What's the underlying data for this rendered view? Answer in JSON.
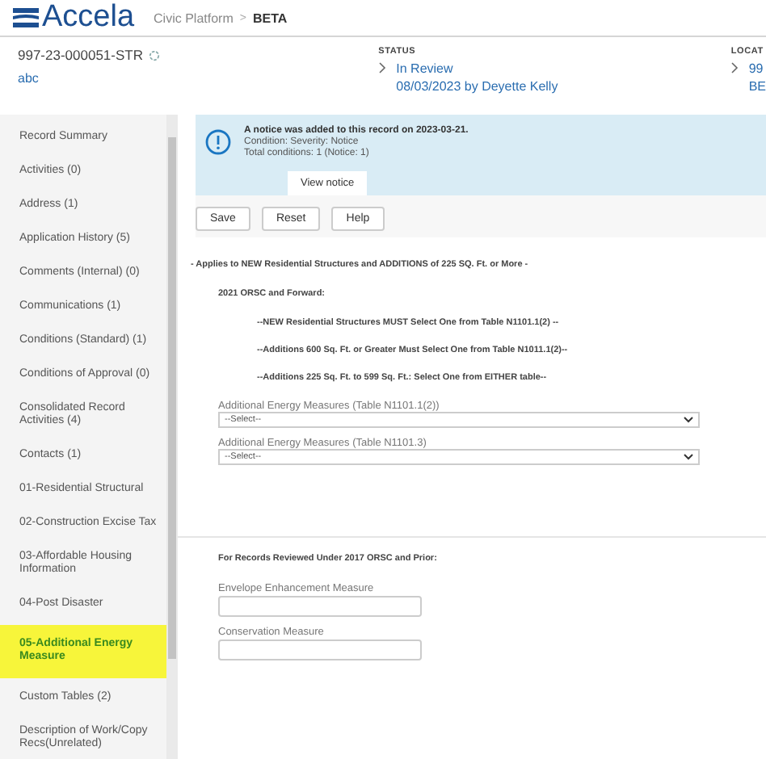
{
  "header": {
    "logo": "Accela",
    "product": "Civic Platform",
    "separator": ">",
    "edition": "BETA"
  },
  "record": {
    "id": "997-23-000051-STR",
    "name": "abc",
    "status_label": "STATUS",
    "status": "In Review",
    "status_detail": "08/03/2023 by Deyette Kelly",
    "location_label": "LOCAT",
    "location_line_1": "99",
    "location_line_2": "BE"
  },
  "sidebar": {
    "items": [
      {
        "label": "Record Summary",
        "selected": false
      },
      {
        "label": "Activities (0)",
        "selected": false
      },
      {
        "label": "Address (1)",
        "selected": false
      },
      {
        "label": "Application History (5)",
        "selected": false
      },
      {
        "label": "Comments (Internal) (0)",
        "selected": false
      },
      {
        "label": "Communications (1)",
        "selected": false
      },
      {
        "label": "Conditions (Standard) (1)",
        "selected": false
      },
      {
        "label": "Conditions of Approval (0)",
        "selected": false
      },
      {
        "label": "Consolidated Record Activities (4)",
        "selected": false
      },
      {
        "label": "Contacts (1)",
        "selected": false
      },
      {
        "label": "01-Residential Structural",
        "selected": false
      },
      {
        "label": "02-Construction Excise Tax",
        "selected": false
      },
      {
        "label": "03-Affordable Housing Information",
        "selected": false
      },
      {
        "label": "04-Post Disaster",
        "selected": false
      },
      {
        "label": "05-Additional Energy Measure",
        "selected": true
      },
      {
        "label": "Custom Tables (2)",
        "selected": false
      },
      {
        "label": "Description of Work/Copy Recs(Unrelated)",
        "selected": false
      }
    ]
  },
  "notice": {
    "title": "A notice was added to this record on 2023-03-21.",
    "lines": [
      "Condition: Severity: Notice",
      "Total conditions: 1   (Notice: 1)"
    ],
    "button": "View notice"
  },
  "buttons": [
    "Save",
    "Reset",
    "Help"
  ],
  "form": [
    {
      "kind": "banner",
      "text": "- Applies to NEW Residential Structures and ADDITIONS of 225 SQ. Ft. or More -"
    },
    {
      "kind": "heading",
      "text": "2021 ORSC and Forward:"
    },
    {
      "kind": "rule",
      "text": "--NEW Residential Structures MUST Select One from Table N1101.1(2) --"
    },
    {
      "kind": "rule",
      "text": "--Additions 600 Sq. Ft. or Greater Must Select One from Table N1011.1(2)--"
    },
    {
      "kind": "rule",
      "text": "--Additions 225 Sq. Ft. to 599 Sq. Ft.: Select One from EITHER table--"
    },
    {
      "kind": "select",
      "label": "Additional Energy Measures (Table N1101.1(2))",
      "value": "--Select--"
    },
    {
      "kind": "select",
      "label": "Additional Energy Measures (Table N1101.3)",
      "value": "--Select--"
    },
    {
      "kind": "divider"
    },
    {
      "kind": "heading",
      "text": "For Records Reviewed Under 2017 ORSC and Prior:"
    },
    {
      "kind": "input",
      "label": "Envelope Enhancement Measure"
    },
    {
      "kind": "input",
      "label": "Conservation Measure"
    }
  ]
}
